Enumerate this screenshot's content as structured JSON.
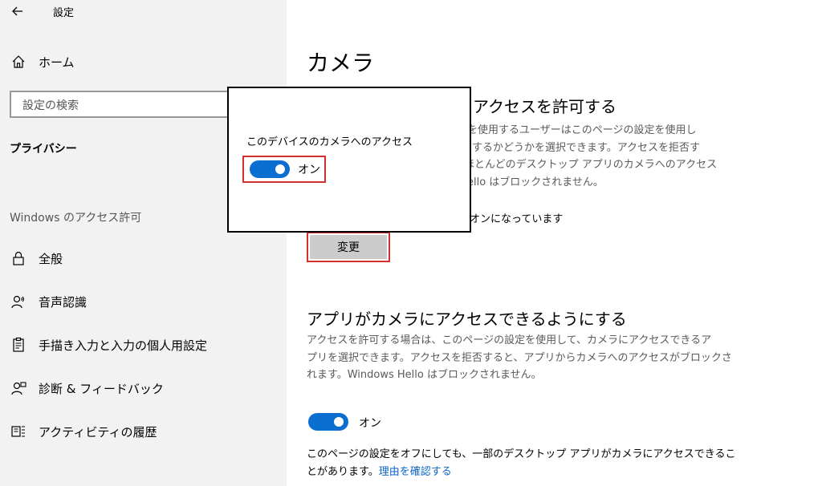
{
  "window": {
    "title": "設定"
  },
  "sidebar": {
    "home_label": "ホーム",
    "search_placeholder": "設定の検索",
    "category": "プライバシー",
    "section_header": "Windows のアクセス許可",
    "items": [
      {
        "label": "全般",
        "icon": "lock-icon"
      },
      {
        "label": "音声認識",
        "icon": "speech-icon"
      },
      {
        "label": "手描き入力と入力の個人用設定",
        "icon": "clipboard-icon"
      },
      {
        "label": "診断 & フィードバック",
        "icon": "feedback-icon"
      },
      {
        "label": "アクティビティの履歴",
        "icon": "activity-icon"
      }
    ]
  },
  "main": {
    "title": "カメラ",
    "section1": {
      "heading_visible": "アクセスを許可する",
      "desc_lines": [
        "スを使用するユーザーはこのページの設定を使用し",
        "可するかどうかを選択できます。アクセスを拒否す",
        "ほとんどのデスクトップ アプリのカメラへのアクセス",
        "ello はブロックされません。"
      ],
      "status_visible": "オンになっています",
      "change_label": "変更"
    },
    "section2": {
      "heading": "アプリがカメラにアクセスできるようにする",
      "desc_lines": [
        "アクセスを許可する場合は、このページの設定を使用して、カメラにアクセスできるア",
        "プリを選択できます。アクセスを拒否すると、アプリからカメラへのアクセスがブロックさ",
        "れます。Windows Hello はブロックされません。"
      ],
      "toggle_label": "オン",
      "toggle_on": true,
      "note_line1": "このページの設定をオフにしても、一部のデスクトップ アプリがカメラにアクセスできるこ",
      "note_line2": "とがあります。",
      "note_link": "理由を確認する"
    }
  },
  "popup": {
    "title": "このデバイスのカメラへのアクセス",
    "toggle_label": "オン",
    "toggle_on": true
  },
  "colors": {
    "accent": "#0a6fd1",
    "highlight": "#d32f2f",
    "sidebar_bg": "#f2f2f2",
    "link": "#0a64c8"
  }
}
